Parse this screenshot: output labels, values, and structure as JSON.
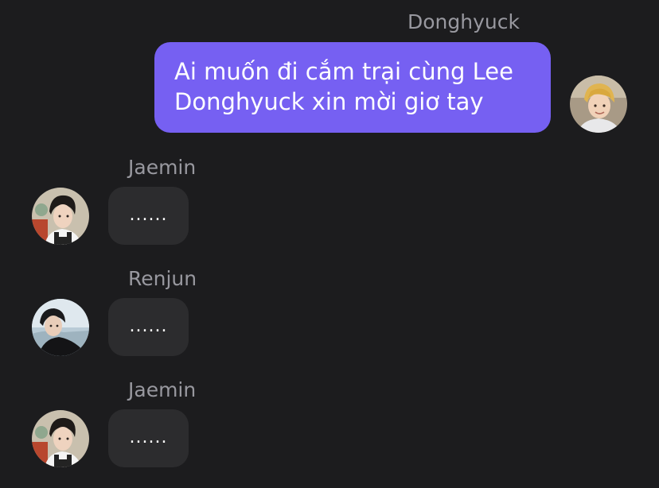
{
  "messages": [
    {
      "sender": "Donghyuck",
      "direction": "outgoing",
      "text": "Ai muốn đi cắm trại cùng Lee Donghyuck xin mời giơ tay",
      "avatar": "profile-photo"
    },
    {
      "sender": "Jaemin",
      "direction": "incoming",
      "text": "......",
      "avatar": "profile-photo"
    },
    {
      "sender": "Renjun",
      "direction": "incoming",
      "text": "......",
      "avatar": "profile-photo"
    },
    {
      "sender": "Jaemin",
      "direction": "incoming",
      "text": "......",
      "avatar": "profile-photo"
    }
  ],
  "colors": {
    "background": "#1c1c1e",
    "outgoing_bubble": "#7660f2",
    "incoming_bubble": "#2c2c2e",
    "name_text": "#98989f",
    "message_text": "#ffffff"
  }
}
